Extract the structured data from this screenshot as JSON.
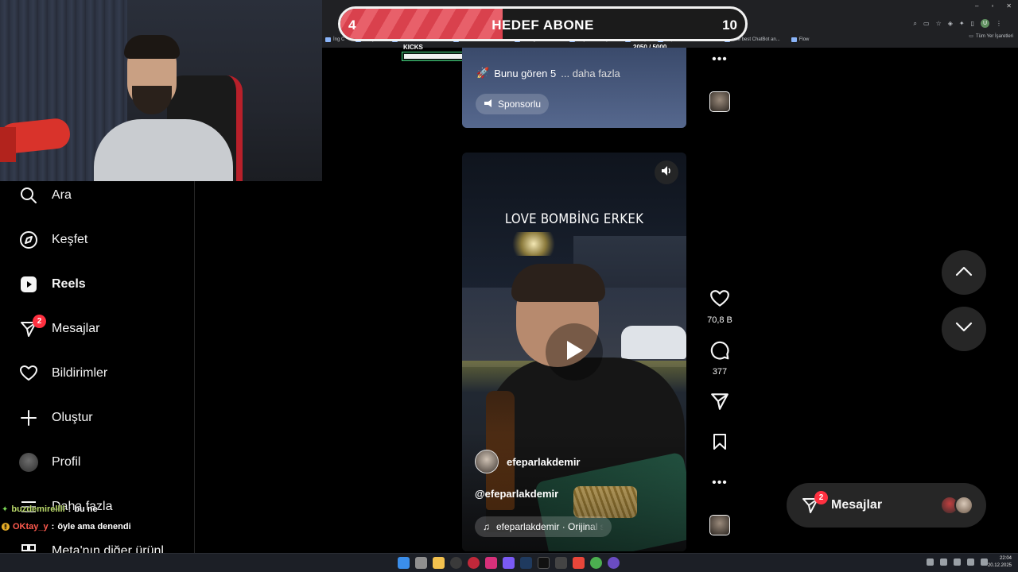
{
  "goal": {
    "current": "4",
    "title": "HEDEF ABONE",
    "target": "10"
  },
  "kicks": {
    "label": "KICKS",
    "count": "2050  / 5000",
    "progress": 0.41
  },
  "browser": {
    "bookmarks": [
      "İng C",
      "ckleye i.",
      "YouTube Thumbnail",
      "Resize and reduce i",
      "Instagram Örnek",
      "HeyGen - Project",
      "BURÇ",
      "Esperanza000 Strea...",
      "The best ChatBot an...",
      "Flow"
    ],
    "all_bookmarks": "Tüm Yer İşaretleri",
    "profile_initial": "U"
  },
  "nav": {
    "items": [
      {
        "label": "Ara",
        "icon": "search-icon"
      },
      {
        "label": "Keşfet",
        "icon": "compass-icon"
      },
      {
        "label": "Reels",
        "icon": "reels-icon"
      },
      {
        "label": "Mesajlar",
        "icon": "messenger-icon",
        "badge": "2"
      },
      {
        "label": "Bildirimler",
        "icon": "heart-icon"
      },
      {
        "label": "Oluştur",
        "icon": "plus-icon"
      },
      {
        "label": "Profil",
        "icon": "profile-avatar"
      },
      {
        "label": "Daha fazla",
        "icon": "menu-icon"
      },
      {
        "label": "Meta'nın diğer ürünl",
        "icon": "meta-icon"
      }
    ]
  },
  "chat": [
    {
      "user": "buzdemirellll",
      "message": "bu ne"
    },
    {
      "user": "OKtay_y",
      "message": "öyle ama denendi"
    }
  ],
  "sponsored_post": {
    "seen_text": "Bunu gören 5",
    "more": "... daha fazla",
    "sponsored_label": "Sponsorlu"
  },
  "reel": {
    "caption": "LOVE BOMBİNG ERKEK",
    "author": "efeparlakdemir",
    "handle": "@efeparlakdemir",
    "audio": "efeparlakdemir · Orijinal ses"
  },
  "actions": {
    "likes": "70,8 B",
    "comments": "377"
  },
  "messages_pill": {
    "label": "Mesajlar",
    "badge": "2"
  },
  "taskbar": {
    "time": "22:04",
    "date": "20.12.2025"
  },
  "colors": {
    "accent_badge": "#ff3040",
    "goal_fill": "#e8606a",
    "kicks_border": "#41d07c"
  }
}
